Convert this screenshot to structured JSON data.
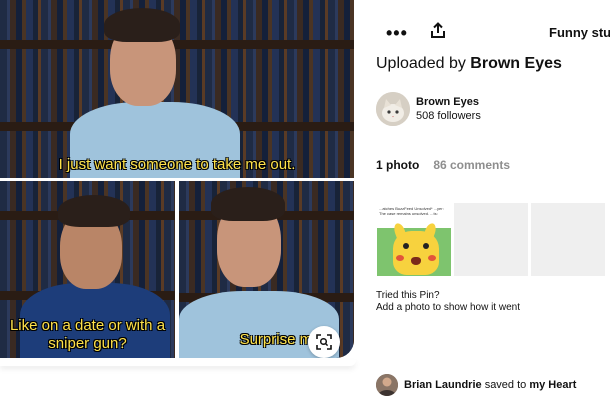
{
  "image": {
    "captions": {
      "top": "I just want someone to take me out.",
      "bottom_left": "Like on a date or with a sniper gun?",
      "bottom_right": "Surprise me"
    },
    "lens_icon": "visual-search-icon"
  },
  "toolbar": {
    "more_label": "•••",
    "more_icon": "more-dots-icon",
    "share_icon": "share-upload-icon",
    "board_name": "Funny stuff"
  },
  "uploader": {
    "prefix": "Uploaded by",
    "name": "Brown Eyes",
    "followers": "508 followers"
  },
  "tabs": [
    {
      "label": "1 photo",
      "active": true
    },
    {
      "label": "86 comments",
      "active": false
    }
  ],
  "photos": {
    "thumb_text": "...atches BuzzFeed Unsolved* ...yer: The case remains unsolved. ...ts:"
  },
  "tried": {
    "line1": "Tried this Pin?",
    "line2": "Add a photo to show how it went"
  },
  "saved": {
    "user": "Brian Laundrie",
    "middle": "saved to",
    "board": "my Heart"
  },
  "colors": {
    "caption_yellow": "#ffe24a",
    "tab_inactive": "#8e8e8e"
  }
}
